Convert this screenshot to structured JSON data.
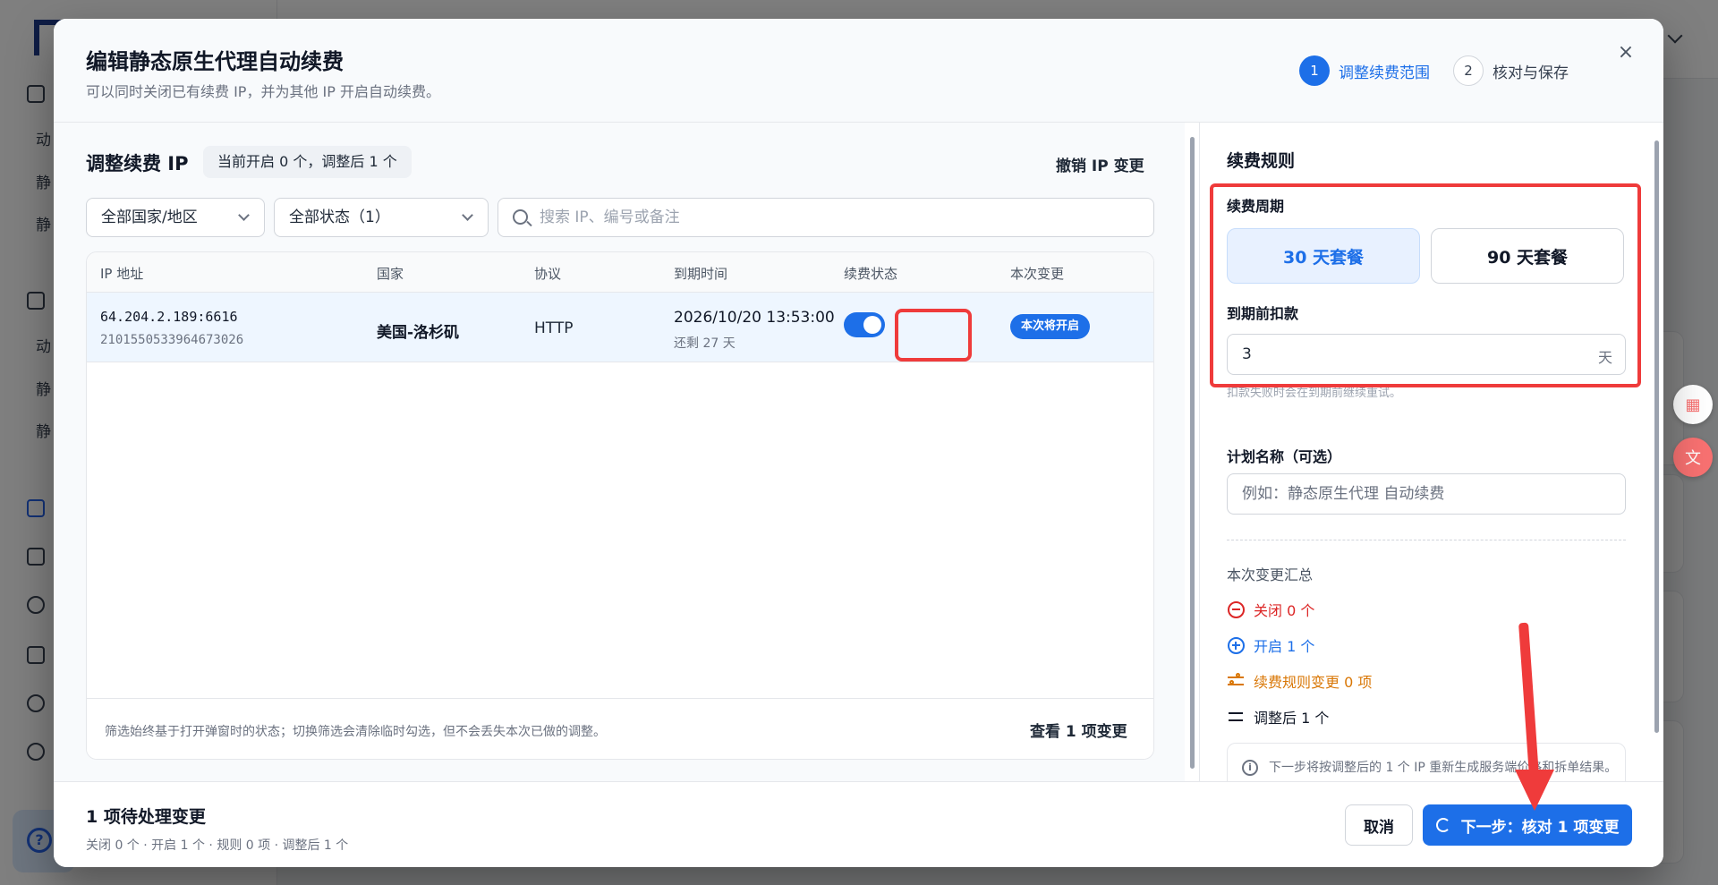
{
  "background": {
    "sidebar_items": [
      "动",
      "静",
      "静",
      "动",
      "静",
      "静"
    ],
    "help_glyph": "?"
  },
  "modal": {
    "title": "编辑静态原生代理自动续费",
    "subtitle": "可以同时关闭已有续费 IP，并为其他 IP 开启自动续费。",
    "close_glyph": "×",
    "steps": [
      {
        "num": "1",
        "label": "调整续费范围"
      },
      {
        "num": "2",
        "label": "核对与保存"
      }
    ]
  },
  "left": {
    "title": "调整续费 IP",
    "count_badge": "当前开启 0 个，调整后 1 个",
    "undo_label": "撤销 IP 变更",
    "filter_country": "全部国家/地区",
    "filter_status": "全部状态（1）",
    "search_placeholder": "搜索 IP、编号或备注",
    "columns": [
      "IP 地址",
      "国家",
      "协议",
      "到期时间",
      "续费状态",
      "本次变更"
    ],
    "rows": [
      {
        "ip": "64.204.2.189:6616",
        "id": "2101550533964673026",
        "country": "美国-洛杉矶",
        "protocol": "HTTP",
        "expire": "2026/10/20 13:53:00",
        "remaining": "还剩 27 天",
        "renew_on": true,
        "change": "本次将开启"
      }
    ],
    "footer_note": "筛选始终基于打开弹窗时的状态；切换筛选会清除临时勾选，但不会丢失本次已做的调整。",
    "footer_link": "查看 1 项变更"
  },
  "right": {
    "title": "续费规则",
    "cycle_label": "续费周期",
    "cycle_options": [
      "30 天套餐",
      "90 天套餐"
    ],
    "selected_cycle": "30 天套餐",
    "deduct_label": "到期前扣款",
    "deduct_value": "3",
    "deduct_unit": "天",
    "deduct_hint": "扣款失败时会在到期前继续重试。",
    "plan_label": "计划名称（可选）",
    "plan_placeholder": "例如：静态原生代理 自动续费",
    "summary_title": "本次变更汇总",
    "summary": {
      "close": "关闭 0 个",
      "open": "开启 1 个",
      "rules": "续费规则变更 0 项",
      "after": "调整后 1 个"
    },
    "info_glyph": "i",
    "info_text": "下一步将按调整后的 1 个 IP 重新生成服务端价格和拆单结果。"
  },
  "footer": {
    "title": "1 项待处理变更",
    "subtitle": "关闭 0 个 · 开启 1 个 · 规则 0 项 · 调整后 1 个",
    "cancel": "取消",
    "next": "下一步：核对 1 项变更"
  },
  "colors": {
    "primary": "#1d6fe8",
    "danger": "#dc2626",
    "warning": "#d97706",
    "annotation": "#ef3b3b"
  }
}
